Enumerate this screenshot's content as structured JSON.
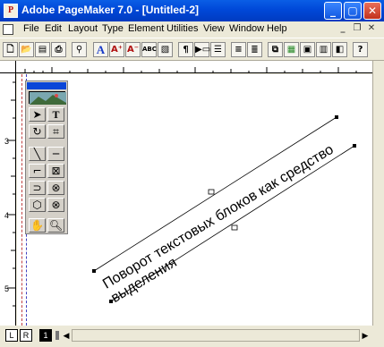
{
  "window": {
    "title": "Adobe PageMaker 7.0 - [Untitled-2]",
    "app_icon": "pm-app-icon"
  },
  "menu": [
    "File",
    "Edit",
    "Layout",
    "Type",
    "Element",
    "Utilities",
    "View",
    "Window",
    "Help"
  ],
  "rulers": {
    "vertical_labels": [
      "3",
      "4",
      "5"
    ]
  },
  "page_tabs": {
    "left_label": "L",
    "right_label": "R",
    "page_number": "1"
  },
  "toolbox": {
    "tools": [
      "pointer-icon",
      "text-icon",
      "rotate-icon",
      "crop-icon",
      "line-icon",
      "constrained-line-icon",
      "rectangle-frame-icon",
      "rectangle-icon",
      "ellipse-frame-icon",
      "ellipse-icon",
      "polygon-frame-icon",
      "polygon-icon",
      "hand-icon",
      "zoom-icon"
    ]
  },
  "text_block": {
    "line1": "Поворот текстовых блоков как средство",
    "line2": "выделения"
  }
}
